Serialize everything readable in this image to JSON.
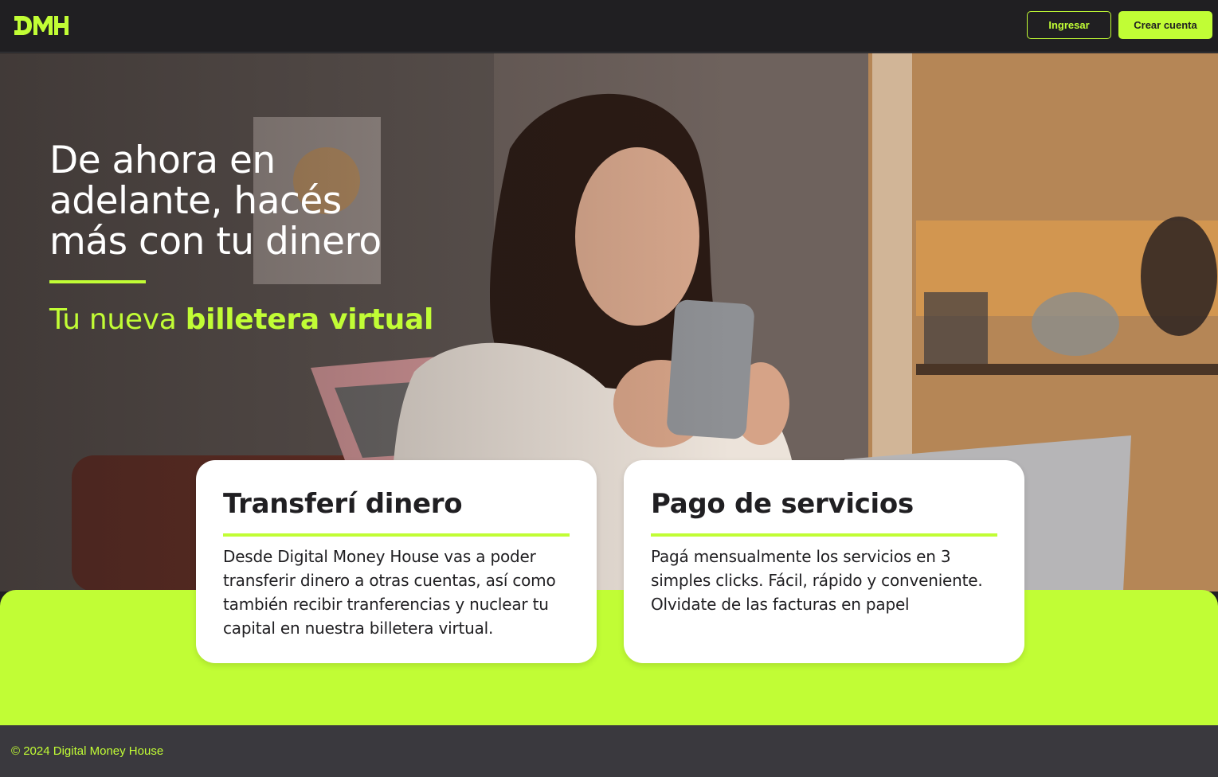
{
  "header": {
    "logo_text": "DMH",
    "login_label": "Ingresar",
    "register_label": "Crear cuenta"
  },
  "hero": {
    "headline_lines": [
      "De ahora en",
      "adelante, hacés",
      "más con tu dinero"
    ],
    "subtitle_prefix": "Tu nueva",
    "subtitle_highlight": "billetera virtual"
  },
  "cards": [
    {
      "title": "Transferí dinero",
      "text": "Desde Digital Money House vas a poder transferir dinero a otras cuentas, así como también recibir tranferencias y nuclear tu capital en nuestra billetera virtual."
    },
    {
      "title": "Pago de servicios",
      "text": "Pagá mensualmente los servicios en 3 simples clicks. Fácil, rápido y conveniente. Olvidate de las facturas en papel"
    }
  ],
  "footer": {
    "copyright": "© 2024 Digital Money House"
  },
  "colors": {
    "accent": "#c1fd35",
    "dark": "#201f22",
    "footer_bg": "#3a393e",
    "card_bg": "#ffffff"
  }
}
